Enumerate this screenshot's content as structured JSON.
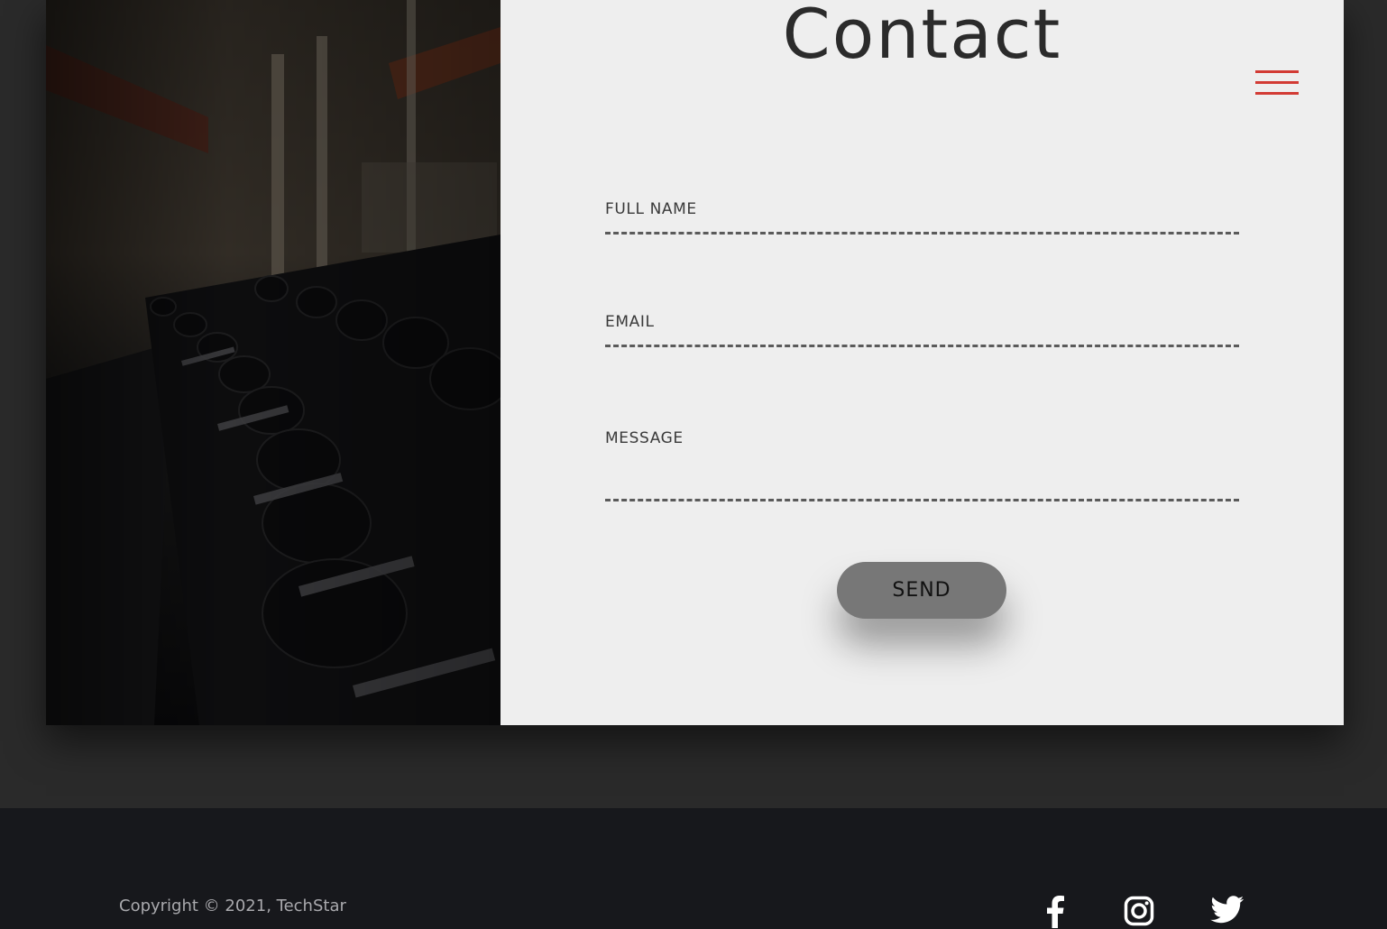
{
  "contact": {
    "title": "Contact",
    "fields": {
      "full_name": {
        "label": "FULL NAME"
      },
      "email": {
        "label": "EMAIL"
      },
      "message": {
        "label": "MESSAGE"
      }
    },
    "send_label": "SEND"
  },
  "menu": {
    "icon": "hamburger-menu-icon",
    "color": "#d23b34"
  },
  "footer": {
    "copyright": "Copyright © 2021, TechStar",
    "social": [
      {
        "icon": "facebook-icon"
      },
      {
        "icon": "instagram-icon"
      },
      {
        "icon": "twitter-icon"
      }
    ]
  },
  "image": {
    "subject": "gym-dumbbell-rack-photo"
  }
}
